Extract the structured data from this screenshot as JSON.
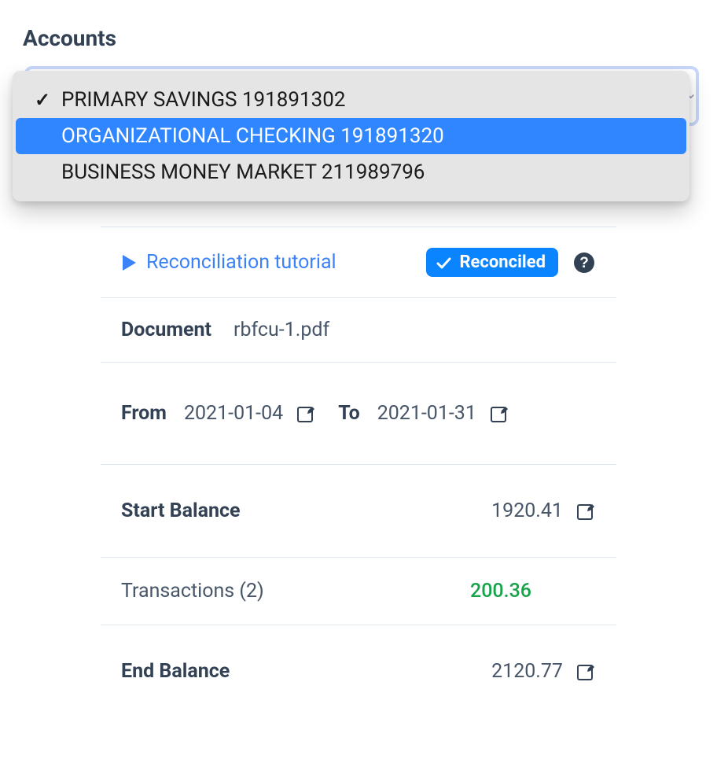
{
  "accounts": {
    "label": "Accounts",
    "options": [
      {
        "label": "PRIMARY SAVINGS 191891302",
        "selected": true,
        "highlighted": false
      },
      {
        "label": "ORGANIZATIONAL CHECKING 191891320",
        "selected": false,
        "highlighted": true
      },
      {
        "label": "BUSINESS MONEY MARKET 211989796",
        "selected": false,
        "highlighted": false
      }
    ]
  },
  "tutorial": {
    "label": "Reconciliation tutorial"
  },
  "reconciled": {
    "label": "Reconciled"
  },
  "document": {
    "label": "Document",
    "value": "rbfcu-1.pdf"
  },
  "dates": {
    "from_label": "From",
    "from_value": "2021-01-04",
    "to_label": "To",
    "to_value": "2021-01-31"
  },
  "start_balance": {
    "label": "Start Balance",
    "value": "1920.41"
  },
  "transactions": {
    "label": "Transactions (2)",
    "amount": "200.36"
  },
  "end_balance": {
    "label": "End Balance",
    "value": "2120.77"
  }
}
